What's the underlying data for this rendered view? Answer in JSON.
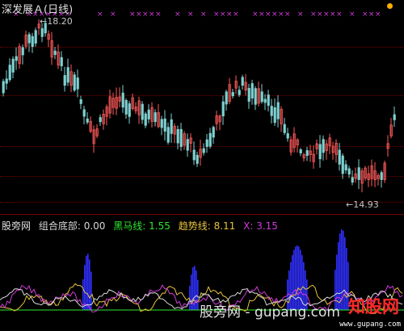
{
  "price_panel": {
    "title": "深发展Ａ(日线)",
    "high_label": "18.20",
    "low_label": "14.93",
    "arrow": "←",
    "arrow_low": "←"
  },
  "indicator_panel": {
    "name": "股旁网",
    "items": [
      {
        "label": "组合底部:",
        "value": "0.00",
        "color": "#d8d8d8"
      },
      {
        "label": "黑马线:",
        "value": "1.55",
        "color": "#2ee82e"
      },
      {
        "label": "趋势线:",
        "value": "8.11",
        "color": "#e8c33a"
      },
      {
        "label": "X:",
        "value": "3.15",
        "color": "#d03ad8"
      }
    ]
  },
  "watermark": {
    "text": "股旁网 - gupang.com"
  },
  "logo": {
    "text": "知股网",
    "sub": "www.gupang.com"
  },
  "colors": {
    "up_candle": "#ff5a5a",
    "down_candle": "#7fd1d1",
    "signal_x": "#d03ad8",
    "bar": "#3030ff",
    "grid": "#7a0000"
  },
  "icons": [
    "signal-x-icon",
    "status-dot-icon"
  ]
}
